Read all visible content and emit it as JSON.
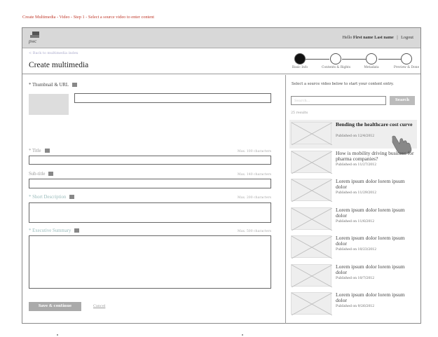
{
  "page_caption": "Create Multimedia - Video - Step 1 - Select a source video to enter content",
  "topbar": {
    "logo_text": "pwc",
    "greeting": "Hello",
    "user_name": "First name Last name",
    "separator": "|",
    "logout_label": "Logout"
  },
  "header": {
    "breadcrumb": "< Back to multimedia index",
    "title": "Create multimedia"
  },
  "steps": [
    {
      "label": "Basic Info",
      "active": true
    },
    {
      "label": "Contents & Rights",
      "active": false
    },
    {
      "label": "Metadata",
      "active": false
    },
    {
      "label": "Preview & Done",
      "active": false
    }
  ],
  "form": {
    "thumb_label": "* Thumbnail & URL",
    "title_label": "* Title",
    "title_max": "Max. 100 characters",
    "subtitle_label": "Sub-title",
    "subtitle_max": "Max. 140 characters",
    "short_desc_label": "* Short Description",
    "short_desc_max": "Max. 200 characters",
    "exec_summary_label": "* Executive Summary",
    "exec_summary_max": "Max. 500 characters",
    "save_label": "Save & continue",
    "cancel_label": "Cancel"
  },
  "source": {
    "instruction": "Select a source video below to start your content entry.",
    "search_placeholder": "Search...",
    "search_button": "Search",
    "result_count": "25 results",
    "videos": [
      {
        "title": "Bending the healthcare cost curve",
        "date": "Published on 12/4/2012",
        "selected": true
      },
      {
        "title": "How is mobility driving business for pharma companies?",
        "date": "Published on 11/27/2012",
        "selected": false
      },
      {
        "title": "Lorem ipsum dolor lorem ipsum dolor",
        "date": "Published on 11/29/2012",
        "selected": false
      },
      {
        "title": "Lorem ipsum dolor lorem ipsum dolor",
        "date": "Published on 11/6/2012",
        "selected": false
      },
      {
        "title": "Lorem ipsum dolor lorem ipsum dolor",
        "date": "Published on 10/23/2012",
        "selected": false
      },
      {
        "title": "Lorem ipsum dolor lorem ipsum dolor",
        "date": "Published on 10/7/2012",
        "selected": false
      },
      {
        "title": "Lorem ipsum dolor lorem ipsum dolor",
        "date": "Published on 9/26/2012",
        "selected": false
      }
    ]
  },
  "icons": {
    "info": "info-icon",
    "pointer": "hand-pointer-icon",
    "placeholder": "image-placeholder-icon"
  },
  "colors": {
    "caption": "#c0392b",
    "topbar": "#d8d8d8",
    "button": "#aaaaaa"
  }
}
